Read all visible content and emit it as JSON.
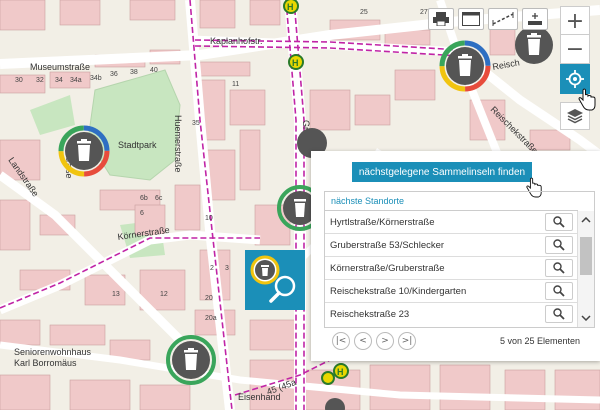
{
  "map": {
    "streets": {
      "museumstrasse": "Museumstraße",
      "kaplanhofstr": "Kaplanhofstr.",
      "huemerstrasse": "Huemerstraße",
      "koernerstrasse": "Körnerstraße",
      "stadtpark": "Stadtpark",
      "reischekstrasse": "Reischekstraße",
      "reisch_short": "Reisch",
      "grub_short": "Grub",
      "landstrasse": "Landstraße",
      "eisenhand": "Eisenhand",
      "seniorenwohnhaus_1": "Seniorenwohnhaus",
      "seniorenwohnhaus_2": "Karl Borromäus",
      "tram_label": "45 (45a"
    },
    "house_numbers": [
      "30",
      "32",
      "34",
      "34a",
      "34b",
      "36",
      "38",
      "40",
      "25",
      "27",
      "11",
      "10",
      "6b",
      "6c",
      "6",
      "35",
      "13",
      "12",
      "2",
      "3",
      "20",
      "20a"
    ],
    "bus_stop_letter": "H"
  },
  "toolbar": {
    "print_icon": "printer-icon",
    "layout_icon": "layout-icon",
    "measure_icon": "measure-icon",
    "plus_icon": "add-feature-icon"
  },
  "controls": {
    "zoom_in": "+",
    "zoom_out": "−",
    "locate_icon": "locate-icon",
    "layers_icon": "layers-icon"
  },
  "panel": {
    "find_button": "nächstgelegene Sammelinseln finden",
    "list_header": "nächste Standorte",
    "rows": [
      "Hyrtlstraße/Körnerstraße",
      "Gruberstraße 53/Schlecker",
      "Körnerstraße/Gruberstraße",
      "Reischekstraße 10/Kindergarten",
      "Reischekstraße 23"
    ],
    "pager_first": "|<",
    "pager_prev": "<",
    "pager_next": ">",
    "pager_last": ">|",
    "pager_info": "5 von 25 Elementen"
  },
  "colors": {
    "accent": "#1b8fb8",
    "tram_line": "#c024a6",
    "building": "#f0c9c9",
    "park": "#c8e6c0",
    "road": "#ffffff"
  }
}
